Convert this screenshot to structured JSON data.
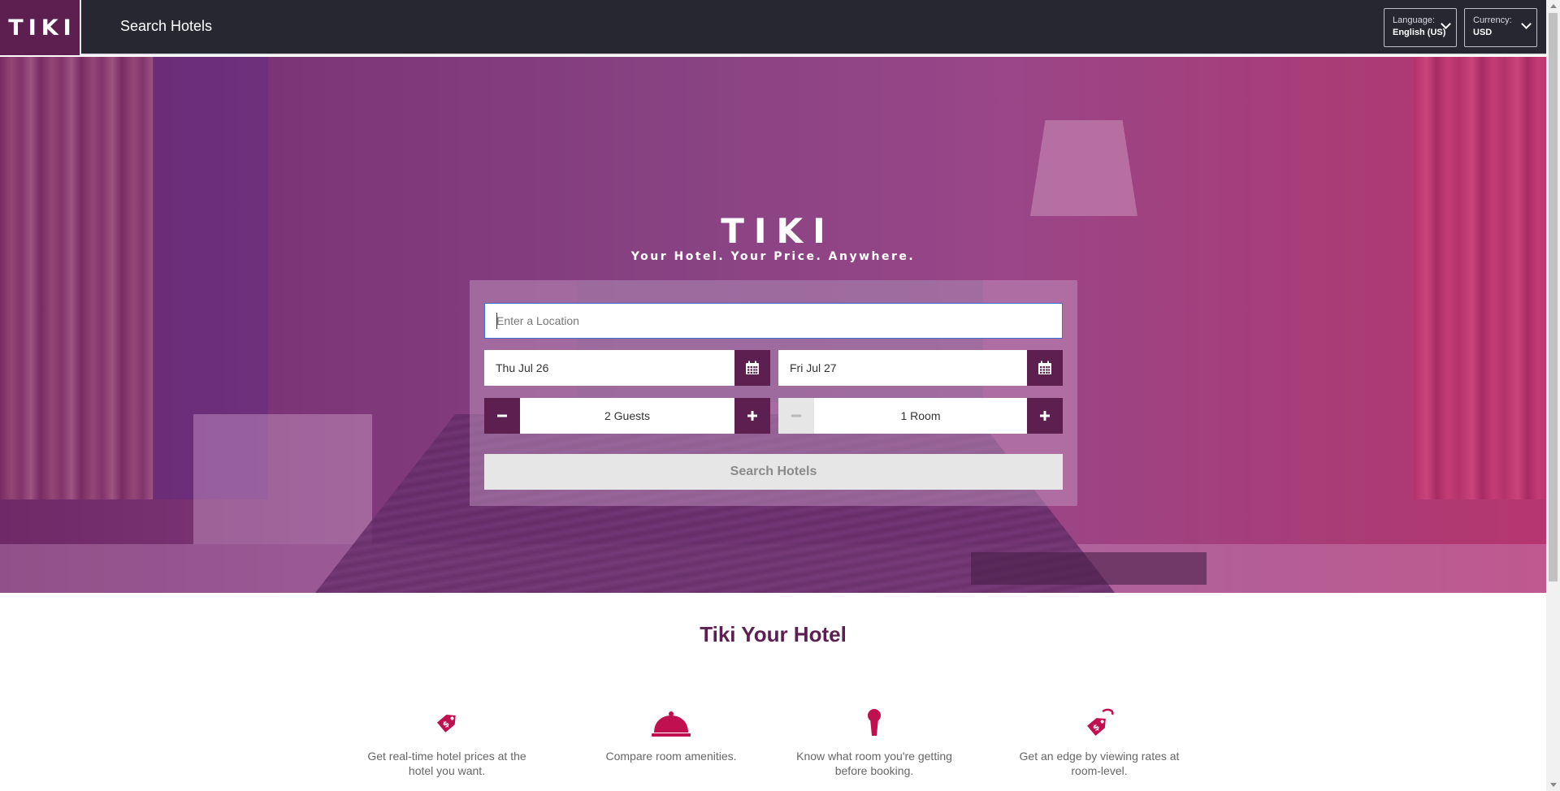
{
  "header": {
    "logo": "TIKI",
    "nav_title": "Search Hotels",
    "language": {
      "label": "Language:",
      "value": "English (US)"
    },
    "currency": {
      "label": "Currency:",
      "value": "USD"
    }
  },
  "hero": {
    "brand": "TIKI",
    "tagline": "Your Hotel. Your Price. Anywhere."
  },
  "search": {
    "location_placeholder": "Enter a Location",
    "checkin": "Thu Jul 26",
    "checkout": "Fri Jul 27",
    "guests": "2 Guests",
    "rooms": "1 Room",
    "submit_label": "Search Hotels"
  },
  "features": {
    "title": "Tiki Your Hotel",
    "items": [
      {
        "icon": "price-tag-icon",
        "text": "Get real-time hotel prices at the hotel you want."
      },
      {
        "icon": "room-service-bell-icon",
        "text": "Compare room amenities."
      },
      {
        "icon": "keyhole-icon",
        "text": "Know what room you're getting before booking."
      },
      {
        "icon": "room-tag-icon",
        "text": "Get an edge by viewing rates at room-level."
      }
    ]
  },
  "colors": {
    "header_bg": "#272732",
    "brand_purple": "#5c1f50",
    "accent_pink": "#c0104f"
  }
}
